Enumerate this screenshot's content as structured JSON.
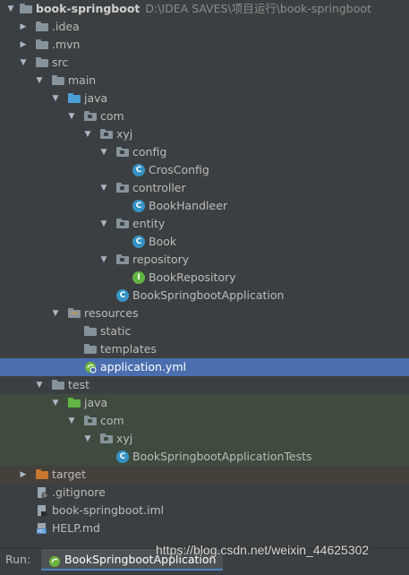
{
  "project": {
    "name": "book-springboot",
    "path": "D:\\IDEA SAVES\\项目运行\\book-springboot"
  },
  "tree": {
    "idea": ".idea",
    "mvn": ".mvn",
    "src": "src",
    "main": "main",
    "java_main": "java",
    "com_main": "com",
    "xyj_main": "xyj",
    "config": "config",
    "cros_config": "CrosConfig",
    "controller": "controller",
    "book_handler": "BookHandleer",
    "entity": "entity",
    "book": "Book",
    "repository": "repository",
    "book_repository": "BookRepository",
    "app_class": "BookSpringbootApplication",
    "resources": "resources",
    "static": "static",
    "templates": "templates",
    "application_yml": "application.yml",
    "test": "test",
    "java_test": "java",
    "com_test": "com",
    "xyj_test": "xyj",
    "app_tests": "BookSpringbootApplicationTests",
    "target": "target",
    "gitignore": ".gitignore",
    "iml": "book-springboot.iml",
    "help": "HELP.md"
  },
  "statusbar": {
    "run_label": "Run:",
    "run_config": "BookSpringbootApplication"
  },
  "watermark": "https://blog.csdn.net/weixin_44625302",
  "colors": {
    "background": "#3c3f41",
    "selection": "#4b6eaf",
    "source_folder": "#4a9fd5",
    "test_folder": "#62b543",
    "excluded_folder": "#c6762d",
    "class_icon": "#3592c4"
  }
}
